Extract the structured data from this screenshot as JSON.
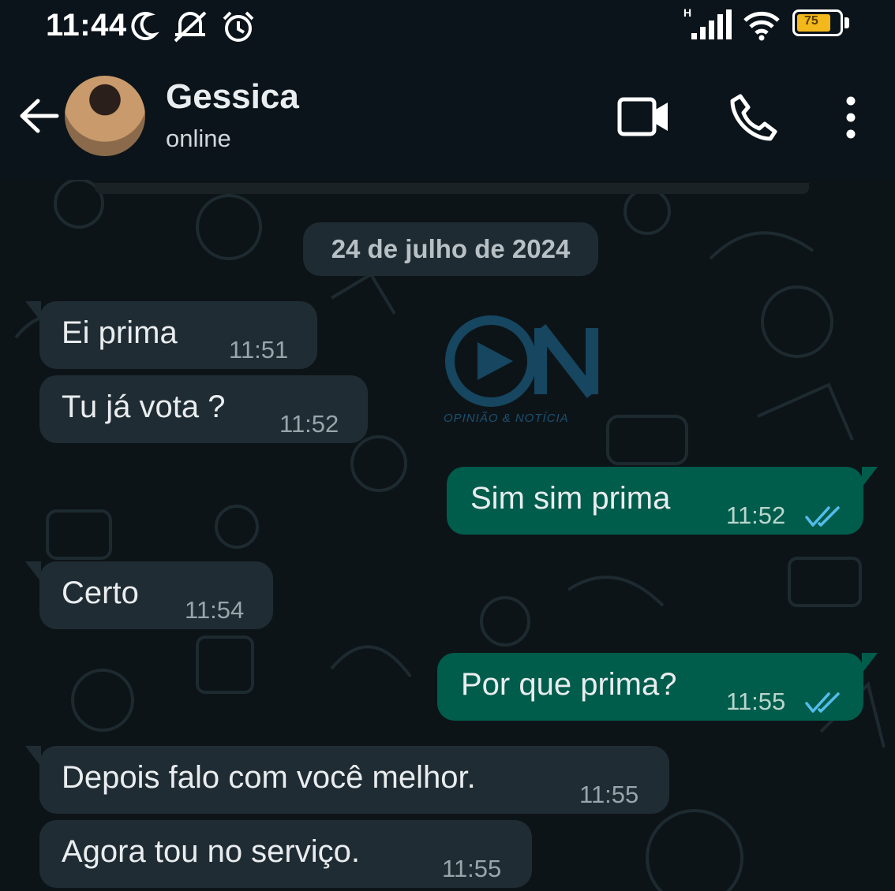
{
  "status_bar": {
    "time": "11:44",
    "icons": [
      "moon-icon",
      "notifications-off-icon",
      "alarm-icon",
      "signal-icon",
      "wifi-icon",
      "battery-icon"
    ],
    "network_label": "H",
    "battery_level": "75"
  },
  "header": {
    "contact_name": "Gessica",
    "contact_status": "online",
    "icons": [
      "back-arrow-icon",
      "video-call-icon",
      "voice-call-icon",
      "more-options-icon"
    ]
  },
  "chat": {
    "date_separator": "24 de julho de 2024",
    "messages": [
      {
        "direction": "incoming",
        "text": "Ei prima",
        "time": "11:51"
      },
      {
        "direction": "incoming",
        "text": "Tu já vota ?",
        "time": "11:52"
      },
      {
        "direction": "outgoing",
        "text": "Sim sim prima",
        "time": "11:52",
        "status": "read"
      },
      {
        "direction": "incoming",
        "text": "Certo",
        "time": "11:54"
      },
      {
        "direction": "outgoing",
        "text": "Por que prima?",
        "time": "11:55",
        "status": "read"
      },
      {
        "direction": "incoming",
        "text": "Depois falo com você melhor.",
        "time": "11:55"
      },
      {
        "direction": "incoming",
        "text": "Agora tou no serviço.",
        "time": "11:55"
      }
    ]
  },
  "watermark": {
    "text": "OPINIÃO & NOTÍCIA"
  },
  "colors": {
    "background": "#0b141a",
    "incoming_bubble": "#202c33",
    "outgoing_bubble": "#005c4b",
    "read_ticks": "#53bdeb"
  }
}
